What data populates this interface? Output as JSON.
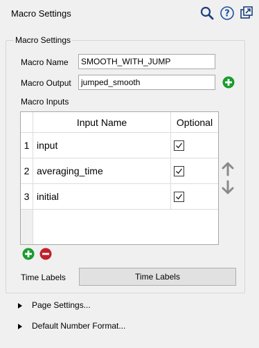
{
  "panel": {
    "title": "Macro Settings",
    "icons": [
      "search-icon",
      "help-icon",
      "popout-icon"
    ]
  },
  "group": {
    "title": "Macro Settings",
    "macro_name_label": "Macro Name",
    "macro_name_value": "SMOOTH_WITH_JUMP",
    "macro_output_label": "Macro Output",
    "macro_output_value": "jumped_smooth",
    "macro_inputs_label": "Macro Inputs",
    "time_labels_label": "Time Labels",
    "time_labels_button": "Time Labels"
  },
  "table": {
    "columns": [
      "Input Name",
      "Optional"
    ],
    "rows": [
      {
        "num": "1",
        "name": "input",
        "optional": true
      },
      {
        "num": "2",
        "name": "averaging_time",
        "optional": true
      },
      {
        "num": "3",
        "name": "initial",
        "optional": true
      }
    ]
  },
  "sections": [
    {
      "label": "Page Settings..."
    },
    {
      "label": "Default Number Format..."
    }
  ],
  "colors": {
    "add_green": "#1a9c2e",
    "remove_red": "#c0212b",
    "icon_blue": "#1a4fa3",
    "arrow_gray": "#8a8a8a"
  }
}
